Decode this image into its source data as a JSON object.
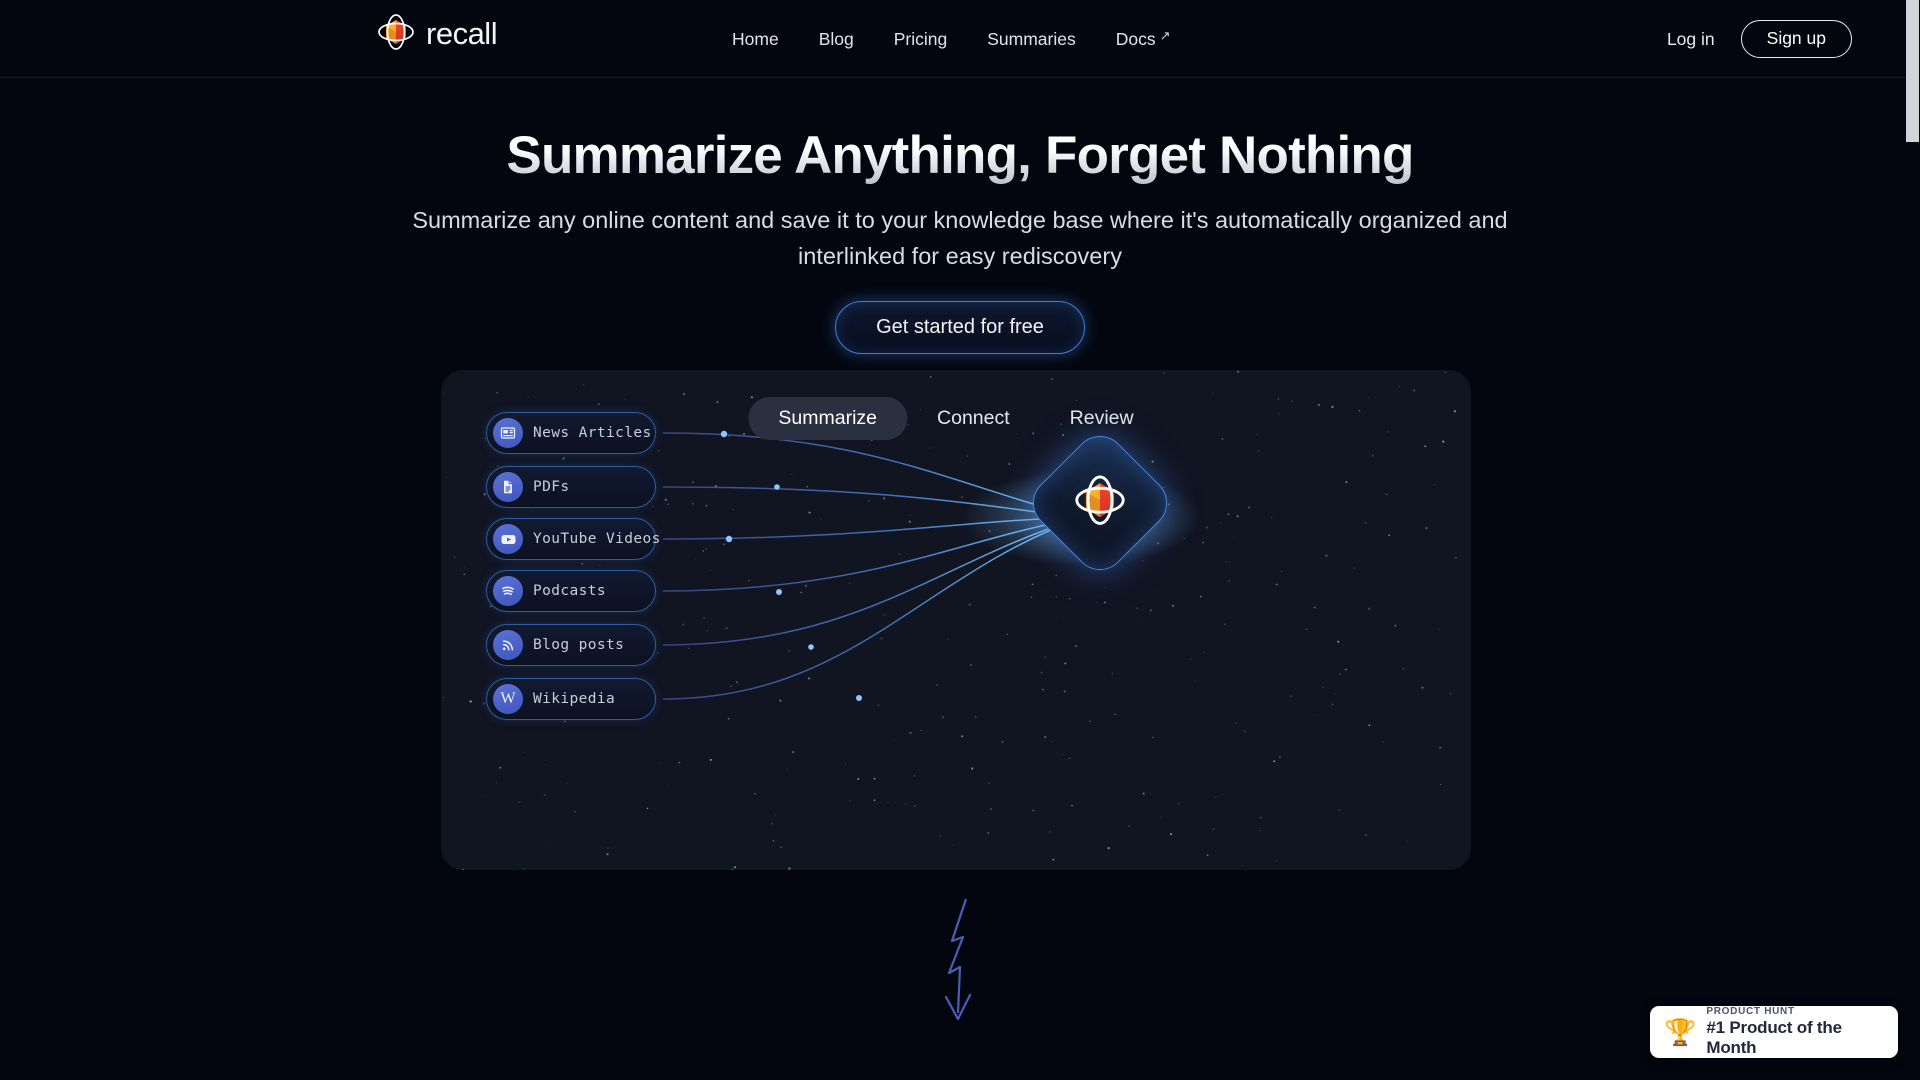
{
  "header": {
    "logo": {
      "name": "recall-logo",
      "wordmark": "recall"
    },
    "nav": [
      {
        "label": "Home",
        "name": "nav-home",
        "external": false
      },
      {
        "label": "Blog",
        "name": "nav-blog",
        "external": false
      },
      {
        "label": "Pricing",
        "name": "nav-pricing",
        "external": false
      },
      {
        "label": "Summaries",
        "name": "nav-summaries",
        "external": false
      },
      {
        "label": "Docs",
        "name": "nav-docs",
        "external": true
      }
    ],
    "ext_arrow_glyph": "↗",
    "login_label": "Log in",
    "signup_label": "Sign up"
  },
  "hero": {
    "title": "Summarize Anything, Forget Nothing",
    "subtitle": "Summarize any online content and save it to your knowledge base where it's automatically organized and interlinked for easy rediscovery",
    "cta_label": "Get started for free"
  },
  "demo": {
    "tabs": [
      {
        "label": "Summarize",
        "active": true
      },
      {
        "label": "Connect",
        "active": false
      },
      {
        "label": "Review",
        "active": false
      }
    ],
    "sources": [
      {
        "label": "News Articles",
        "icon": "newspaper-icon"
      },
      {
        "label": "PDFs",
        "icon": "document-icon"
      },
      {
        "label": "YouTube Videos",
        "icon": "youtube-icon"
      },
      {
        "label": "Podcasts",
        "icon": "spotify-icon"
      },
      {
        "label": "Blog posts",
        "icon": "rss-icon"
      },
      {
        "label": "Wikipedia",
        "icon": "wikipedia-icon"
      }
    ],
    "hub": {
      "name": "recall-hub-node"
    }
  },
  "product_hunt": {
    "kicker": "PRODUCT HUNT",
    "title": "#1 Product of the Month",
    "trophy_glyph": "🏆"
  },
  "colors": {
    "page_background": "#03060f",
    "card_background": "#111421",
    "accent_blue": "#4b86da",
    "logo_orange": "#f2a93b",
    "logo_red": "#e0392c",
    "text_primary": "#ffffff",
    "text_secondary": "#d7dce6"
  }
}
